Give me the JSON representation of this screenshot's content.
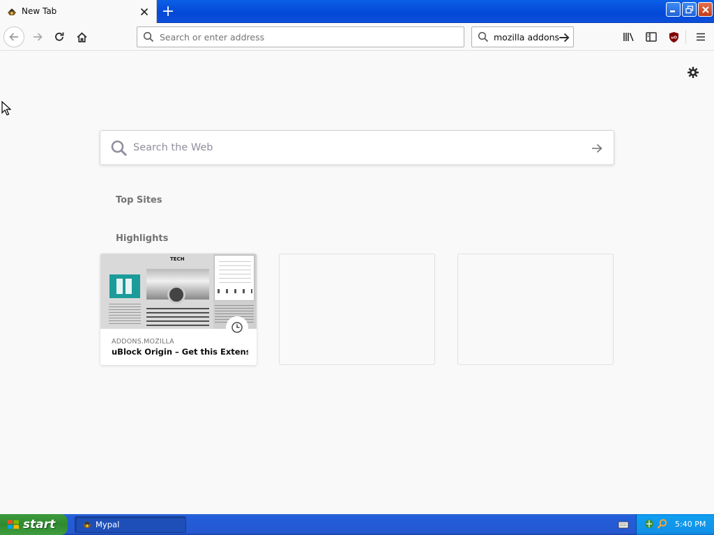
{
  "tab": {
    "title": "New Tab"
  },
  "navbar": {
    "url_placeholder": "Search or enter address",
    "search_value": "mozilla addons"
  },
  "content": {
    "web_search_placeholder": "Search the Web",
    "top_sites_title": "Top Sites",
    "highlights_title": "Highlights",
    "highlights": [
      {
        "host": "ADDONS.MOZILLA",
        "title": "uBlock Origin – Get this Extensio...",
        "thumb_heading": "TECH"
      }
    ]
  },
  "taskbar": {
    "start_label": "start",
    "task_label": "Mypal",
    "clock": "5:40 PM"
  },
  "colors": {
    "titlebar": "#0b4fd9",
    "page_bg": "#f9f9fa",
    "start_green": "#3c9a3c",
    "tray_blue": "#1290e6"
  },
  "icons": {
    "tab": "mypal-icon",
    "close": "close-icon",
    "new_tab": "plus-icon",
    "back": "back-arrow-icon",
    "forward": "forward-arrow-icon",
    "reload": "reload-icon",
    "home": "home-icon",
    "search": "search-icon",
    "library": "library-icon",
    "sidebar": "sidebar-icon",
    "ublock": "ublock-icon",
    "menu": "hamburger-menu-icon",
    "settings": "gear-icon",
    "history": "clock-icon"
  }
}
